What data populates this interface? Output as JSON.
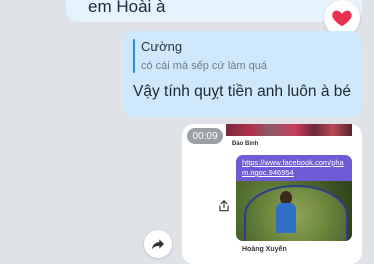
{
  "messages": {
    "top_bubble_text": "em Hoài à",
    "reaction": "heart",
    "reply": {
      "quote_author": "Cường",
      "quote_text": "có cái mà sếp cứ làm quá",
      "text": "Vậy tính quỵt tiền anh luôn à bé"
    },
    "video": {
      "duration": "00:09",
      "sender_name": "Đào Bình",
      "link_text": "https://www.facebook.com/pham.ngoc.946954",
      "bottom_name": "Hoàng Xuyến"
    }
  },
  "colors": {
    "accent": "#1f8fea",
    "bubble": "#cfe8fb",
    "heart": "#e8324f"
  },
  "icons": [
    "heart-icon",
    "share-icon",
    "forward-arrow-icon"
  ]
}
